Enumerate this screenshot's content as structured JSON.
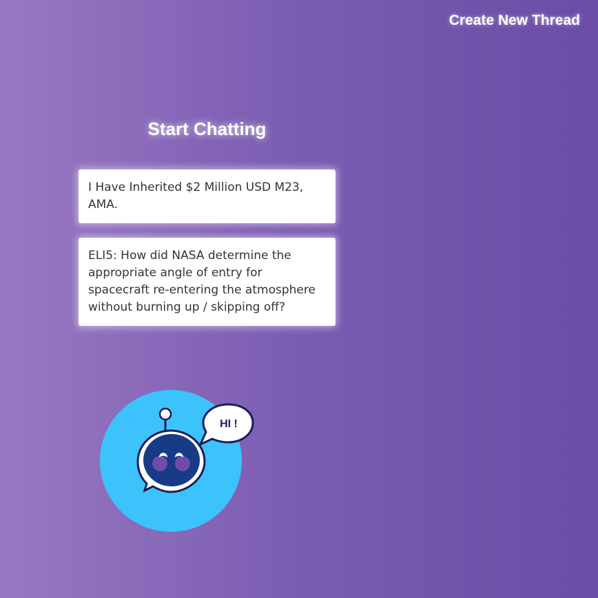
{
  "header": {
    "create_thread_label": "Create New Thread"
  },
  "main": {
    "title": "Start Chatting",
    "threads": [
      {
        "text": "I Have Inherited $2 Million USD M23, AMA."
      },
      {
        "text": "ELI5: How did NASA determine the appropriate angle of entry for spacecraft re-entering the atmosphere without burning up / skipping off?"
      }
    ]
  },
  "mascot": {
    "bubble_text": "HI !",
    "icon": "robot-chat-icon"
  },
  "colors": {
    "background_start": "#9878c2",
    "background_end": "#6b4ca7",
    "mascot_circle": "#3cc3fb",
    "robot_face": "#173b86",
    "outline": "#1c1c5a"
  }
}
